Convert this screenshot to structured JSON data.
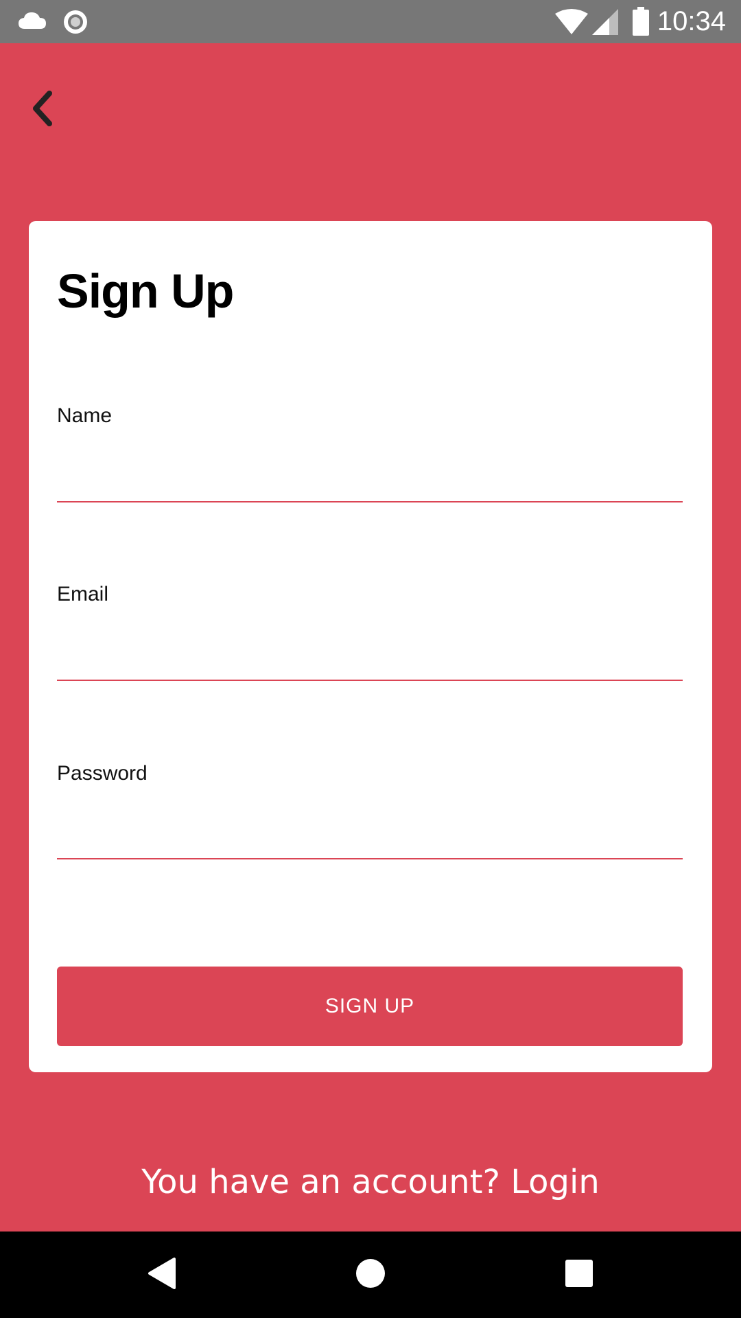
{
  "status_bar": {
    "time": "10:34",
    "icons": [
      "cloud-icon",
      "record-icon",
      "wifi-icon",
      "signal-icon",
      "battery-icon"
    ]
  },
  "header": {
    "back_icon": "chevron-left-icon"
  },
  "form": {
    "title": "Sign Up",
    "fields": [
      {
        "label": "Name",
        "value": ""
      },
      {
        "label": "Email",
        "value": ""
      },
      {
        "label": "Password",
        "value": ""
      }
    ],
    "submit_label": "SIGN UP"
  },
  "footer": {
    "login_prompt": "You have an account? Login"
  },
  "nav": {
    "icons": [
      "back-triangle-icon",
      "home-circle-icon",
      "recents-square-icon"
    ]
  },
  "colors": {
    "accent": "#db4555",
    "card": "#ffffff",
    "status_bar": "#777777",
    "nav_bar": "#000000"
  }
}
